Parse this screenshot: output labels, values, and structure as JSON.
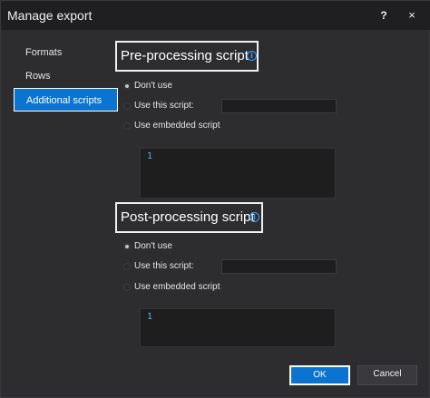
{
  "window": {
    "title": "Manage export",
    "help_label": "?",
    "close_label": "×"
  },
  "sidebar": {
    "items": [
      {
        "label": "Formats"
      },
      {
        "label": "Rows"
      },
      {
        "label": "Additional scripts",
        "active": true
      }
    ]
  },
  "pre": {
    "title": "Pre-processing script",
    "info_icon": "i",
    "options": [
      {
        "label": "Don't use",
        "selected": true
      },
      {
        "label": "Use this script:",
        "selected": false
      },
      {
        "label": "Use embedded script",
        "selected": false
      }
    ],
    "script_value": "",
    "editor_line": "1"
  },
  "post": {
    "title": "Post-processing script",
    "info_icon": "i",
    "options": [
      {
        "label": "Don't use",
        "selected": true
      },
      {
        "label": "Use this script:",
        "selected": false
      },
      {
        "label": "Use embedded script",
        "selected": false
      }
    ],
    "script_value": "",
    "editor_line": "1"
  },
  "buttons": {
    "ok": "OK",
    "cancel": "Cancel"
  },
  "colors": {
    "accent": "#0a74d0",
    "background": "#2d2d30",
    "titlebar": "#1f1f22"
  }
}
